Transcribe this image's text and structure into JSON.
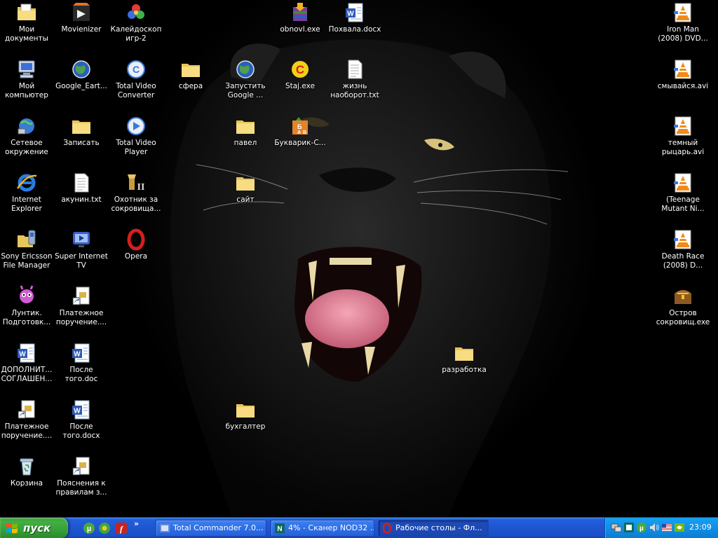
{
  "desktop": {
    "icons": [
      {
        "id": "my-documents-icon",
        "label": "Мои документы",
        "kind": "mydocs"
      },
      {
        "id": "my-computer-icon",
        "label": "Мой компьютер",
        "kind": "computer"
      },
      {
        "id": "network-icon",
        "label": "Сетевое окружение",
        "kind": "network"
      },
      {
        "id": "internet-explorer-icon",
        "label": "Internet Explorer",
        "kind": "ie"
      },
      {
        "id": "sony-ericsson-icon",
        "label": "Sony Ericsson File Manager",
        "kind": "folder-phone"
      },
      {
        "id": "luntik-icon",
        "label": "Лунтик. Подготовк...",
        "kind": "luntik"
      },
      {
        "id": "word-doc-dopolnit-icon",
        "label": "ДОПОЛНИТ... СОГЛАШЕН...",
        "kind": "word"
      },
      {
        "id": "payment-doc-1-icon",
        "label": "Платежное поручение....",
        "kind": "shortcut-doc"
      },
      {
        "id": "recycle-bin-icon",
        "label": "Корзина",
        "kind": "recycle"
      },
      {
        "id": "movienizer-icon",
        "label": "Movienizer",
        "kind": "movienizer"
      },
      {
        "id": "google-earth-icon",
        "label": "Google_Eart...",
        "kind": "earth"
      },
      {
        "id": "zapisat-folder-icon",
        "label": "Записать",
        "kind": "folder"
      },
      {
        "id": "akunin-txt-icon",
        "label": "акунин.txt",
        "kind": "txt"
      },
      {
        "id": "super-internet-tv-icon",
        "label": "Super Internet TV",
        "kind": "tv"
      },
      {
        "id": "payment-doc-2-icon",
        "label": "Платежное поручение....",
        "kind": "shortcut-doc"
      },
      {
        "id": "posle-doc-icon",
        "label": "После того.doc",
        "kind": "word"
      },
      {
        "id": "posle-docx-icon",
        "label": "После того.docx",
        "kind": "word"
      },
      {
        "id": "poyasneniya-icon",
        "label": "Пояснения к правилам з...",
        "kind": "shortcut-doc"
      },
      {
        "id": "kaleidoscope-icon",
        "label": "Калейдоскоп игр-2",
        "kind": "kaleido"
      },
      {
        "id": "total-video-converter-icon",
        "label": "Total Video Converter",
        "kind": "tvc"
      },
      {
        "id": "total-video-player-icon",
        "label": "Total Video Player",
        "kind": "tvp"
      },
      {
        "id": "treasure-hunter-icon",
        "label": "Охотник за сокровища...",
        "kind": "hunter"
      },
      {
        "id": "opera-icon",
        "label": "Opera",
        "kind": "opera"
      },
      {
        "id": "sfera-folder-icon",
        "label": "сфера",
        "kind": "folder"
      },
      {
        "id": "google-launch-icon",
        "label": "Запустить Google ...",
        "kind": "earth"
      },
      {
        "id": "pavel-folder-icon",
        "label": "павел",
        "kind": "folder"
      },
      {
        "id": "sait-folder-icon",
        "label": "сайт",
        "kind": "folder"
      },
      {
        "id": "buhgalter-folder-icon",
        "label": "бухгалтер",
        "kind": "folder"
      },
      {
        "id": "obnovl-exe-icon",
        "label": "obnovl.exe",
        "kind": "winrar"
      },
      {
        "id": "staj-exe-icon",
        "label": "Staj.exe",
        "kind": "staj"
      },
      {
        "id": "bukvarik-icon",
        "label": "Букварик-С...",
        "kind": "bukvarik"
      },
      {
        "id": "pohvala-docx-icon",
        "label": "Похвала.docx",
        "kind": "word"
      },
      {
        "id": "zhizn-txt-icon",
        "label": "жизнь наоборот.txt",
        "kind": "txt"
      },
      {
        "id": "razrabotka-folder-icon",
        "label": "разработка",
        "kind": "folder"
      },
      {
        "id": "iron-man-icon",
        "label": "Iron Man (2008) DVD...",
        "kind": "vlc"
      },
      {
        "id": "smyvaysya-icon",
        "label": "смывайся.avi",
        "kind": "vlc"
      },
      {
        "id": "temny-rytsar-icon",
        "label": "темный рыцарь.avi",
        "kind": "vlc"
      },
      {
        "id": "teenage-mutant-icon",
        "label": "(Teenage Mutant Ni...",
        "kind": "vlc"
      },
      {
        "id": "death-race-icon",
        "label": "Death Race (2008) D...",
        "kind": "vlc"
      },
      {
        "id": "ostrov-icon",
        "label": "Остров сокровищ.exe",
        "kind": "chest"
      }
    ]
  },
  "taskbar": {
    "start_label": "пуск",
    "quick_launch": [
      {
        "id": "ql-utorrent-icon",
        "kind": "utorrent"
      },
      {
        "id": "ql-icq-icon",
        "kind": "icq"
      },
      {
        "id": "ql-flash-icon",
        "kind": "flash"
      }
    ],
    "chevron": "»",
    "tasks": [
      {
        "id": "task-total-commander",
        "label": "Total Commander 7.0...",
        "kind": "tc",
        "active": false
      },
      {
        "id": "task-nod32",
        "label": "4% - Сканер NOD32 ...",
        "kind": "nod",
        "active": false
      },
      {
        "id": "task-opera",
        "label": "Рабочие столы - Фл...",
        "kind": "opera",
        "active": true
      }
    ],
    "tray": {
      "icons": [
        "network-tray-icon",
        "nod32-tray-icon",
        "utorrent-tray-icon",
        "volume-icon",
        "language-flag-icon",
        "nvidia-icon"
      ],
      "clock": "23:09"
    }
  }
}
